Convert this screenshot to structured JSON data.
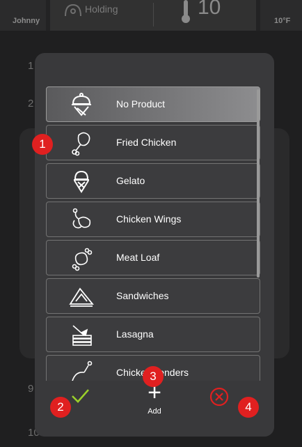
{
  "header": {
    "user": "Johnny",
    "mode": "Holding",
    "temperature_large": "10",
    "temperature_small": "10°F"
  },
  "slots": [
    "1",
    "2",
    "9",
    "10"
  ],
  "product_list": {
    "items": [
      {
        "label": "No Product",
        "icon": "no-product-cloche-icon",
        "selected": true
      },
      {
        "label": "Fried Chicken",
        "icon": "fried-chicken-icon",
        "selected": false
      },
      {
        "label": "Gelato",
        "icon": "gelato-icon",
        "selected": false
      },
      {
        "label": "Chicken Wings",
        "icon": "chicken-wings-icon",
        "selected": false
      },
      {
        "label": "Meat Loaf",
        "icon": "meat-loaf-icon",
        "selected": false
      },
      {
        "label": "Sandwiches",
        "icon": "sandwich-icon",
        "selected": false
      },
      {
        "label": "Lasagna",
        "icon": "lasagna-icon",
        "selected": false
      },
      {
        "label": "Chicken Tenders",
        "icon": "chicken-tenders-icon",
        "selected": false
      }
    ]
  },
  "actions": {
    "add_label": "Add",
    "confirm_icon": "checkmark-icon",
    "cancel_icon": "close-circle-icon"
  },
  "badges": [
    "1",
    "2",
    "3",
    "4"
  ],
  "colors": {
    "badge": "#e02020",
    "confirm": "#9bd12a",
    "cancel": "#e02020"
  }
}
